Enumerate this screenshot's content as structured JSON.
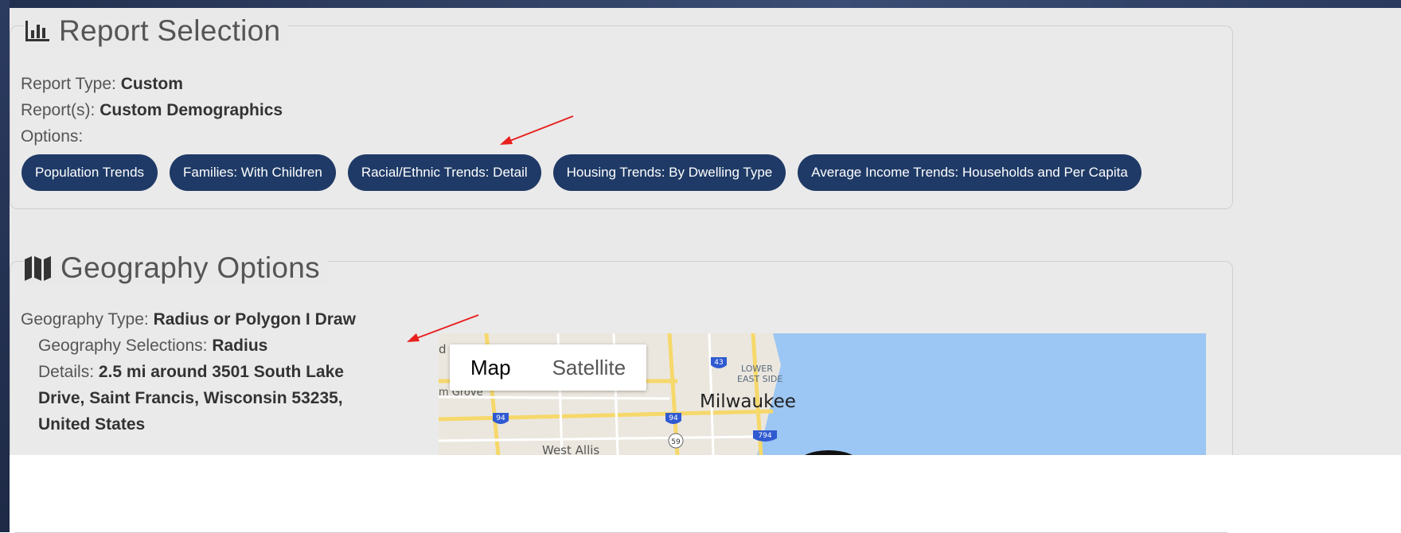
{
  "report_section": {
    "title": "Report Selection",
    "icon": "bar-chart-icon",
    "type_label": "Report Type:",
    "type_value": "Custom",
    "reports_label": "Report(s):",
    "reports_value": "Custom Demographics",
    "options_label": "Options:",
    "options": [
      "Population Trends",
      "Families: With Children",
      "Racial/Ethnic Trends: Detail",
      "Housing Trends: By Dwelling Type",
      "Average Income Trends: Households and Per Capita"
    ]
  },
  "geography_section": {
    "title": "Geography Options",
    "icon": "map-icon",
    "type_label": "Geography Type:",
    "type_value": "Radius or Polygon I Draw",
    "selections_label": "Geography Selections:",
    "selections_value": "Radius",
    "details_label": "Details:",
    "details_value_1": "2.5 mi around 3501 South Lake",
    "details_value_2": "Drive, Saint Francis, Wisconsin 53235,",
    "details_value_3": "United States"
  },
  "map": {
    "toggle_map": "Map",
    "toggle_satellite": "Satellite",
    "labels": {
      "city": "Milwaukee",
      "district_1": "LOWER",
      "district_2": "EAST SIDE",
      "west": "West Allis",
      "grove": "m Grove",
      "d": "d"
    },
    "shields": {
      "i43": "43",
      "i94a": "94",
      "i94b": "94",
      "i794": "794",
      "us59": "59"
    }
  },
  "colors": {
    "pill_bg": "#1f3a66",
    "arrow": "#e8201e",
    "water": "#9cc6f3"
  }
}
